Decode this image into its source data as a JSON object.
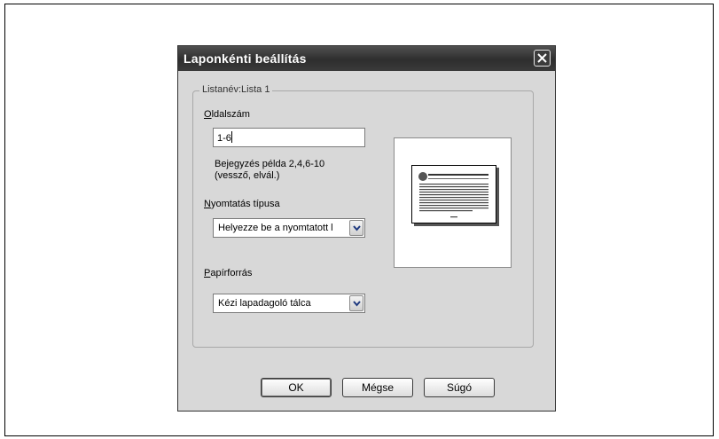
{
  "dialog": {
    "title": "Laponkénti beállítás",
    "close_icon": "close-icon"
  },
  "group": {
    "legend": "Listanév:Lista 1"
  },
  "page_number": {
    "label_accel": "O",
    "label_rest": "ldalszám",
    "value": "1-6",
    "hint_line1": "Bejegyzés példa 2,4,6-10",
    "hint_line2": "(vessző, elvál.)"
  },
  "print_type": {
    "label_accel": "N",
    "label_rest": "yomtatás típusa",
    "selected": "Helyezze be a nyomtatott l"
  },
  "paper_source": {
    "label_accel": "P",
    "label_rest": "apírforrás",
    "selected": "Kézi lapadagoló tálca"
  },
  "buttons": {
    "ok": "OK",
    "cancel": "Mégse",
    "help": "Súgó"
  },
  "colors": {
    "title_bar": "#3a3a3a",
    "dialog_bg": "#d8d8d8"
  }
}
